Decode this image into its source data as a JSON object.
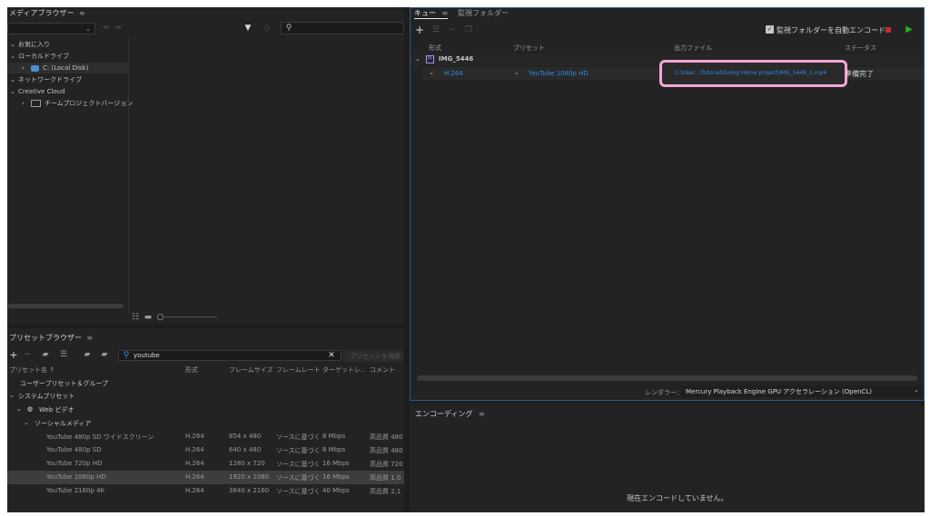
{
  "media_browser": {
    "title": "メディアブラウザー",
    "tree": {
      "favorites": "お気に入り",
      "local_drives": "ローカルドライブ",
      "c_drive": "C: (Local Disk)",
      "network_drives": "ネットワークドライブ",
      "creative_cloud": "Creative Cloud",
      "team_project": "チームプロジェクトバージョン"
    }
  },
  "preset_browser": {
    "title": "プリセットブラウザー",
    "search_value": "youtube",
    "apply_button": "プリセットを適用",
    "columns": [
      "プリセット名 ↑",
      "形式",
      "フレームサイズ",
      "フレームレート",
      "ターゲットレ..",
      "コメント"
    ],
    "user_group": "ユーザープリセット＆グループ",
    "system_presets": "システムプリセット",
    "web_video": "Web ビデオ",
    "social_media": "ソーシャルメディア",
    "rows": [
      {
        "name": "YouTube 480p SD ワイドスクリーン",
        "format": "H.264",
        "size": "854 x 480",
        "rate": "ソースに基づく",
        "target": "8 Mbps",
        "comment": "高品質 480"
      },
      {
        "name": "YouTube 480p SD",
        "format": "H.264",
        "size": "640 x 480",
        "rate": "ソースに基づく",
        "target": "8 Mbps",
        "comment": "高品質 480"
      },
      {
        "name": "YouTube 720p HD",
        "format": "H.264",
        "size": "1280 x 720",
        "rate": "ソースに基づく",
        "target": "16 Mbps",
        "comment": "高品質 720"
      },
      {
        "name": "YouTube 1080p HD",
        "format": "H.264",
        "size": "1920 x 1080",
        "rate": "ソースに基づく",
        "target": "16 Mbps",
        "comment": "高品質 1,0"
      },
      {
        "name": "YouTube 2160p 4K",
        "format": "H.264",
        "size": "3840 x 2160",
        "rate": "ソースに基づく",
        "target": "40 Mbps",
        "comment": "高品質 2,1"
      }
    ]
  },
  "queue": {
    "tab_queue": "キュー",
    "tab_watch": "監視フォルダー",
    "auto_encode_label": "監視フォルダーを自動エンコード",
    "columns": {
      "format": "形式",
      "preset": "プリセット",
      "output": "出力ファイル",
      "status": "ステータス"
    },
    "item": {
      "name": "IMG_5446",
      "badge": "Pr",
      "format": "H.264",
      "preset": "YouTube 1080p HD",
      "output": "C:\\User...\\Tutorial\\Going Home project\\IMG_5446_1.mp4",
      "status": "準備完了"
    },
    "renderer_label": "レンダラー：",
    "renderer_value": "Mercury Playback Engine GPU アクセラレーション (OpenCL)"
  },
  "encoding": {
    "title": "エンコーディング",
    "message": "現在エンコードしていません。"
  },
  "colors": {
    "accent": "#2d8ceb",
    "highlight": "#f3a8d6",
    "play": "#1fb80f",
    "stop": "#c42b2b",
    "pr_badge": "#9999ff"
  }
}
